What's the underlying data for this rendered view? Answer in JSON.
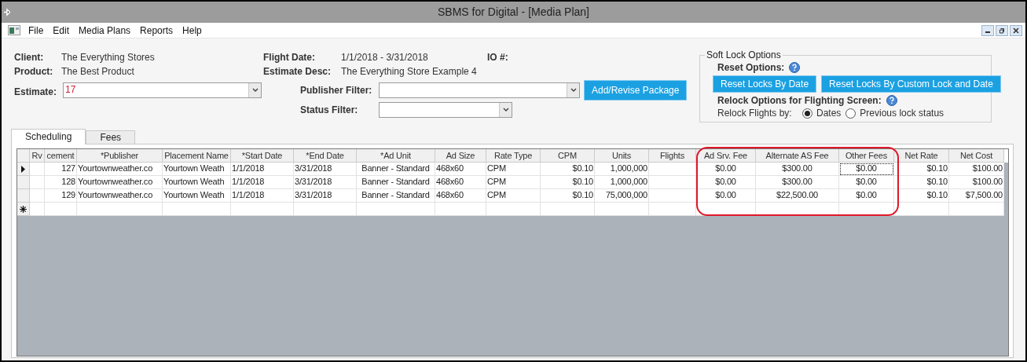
{
  "window": {
    "title": "SBMS for Digital - [Media Plan]"
  },
  "menu": [
    "File",
    "Edit",
    "Media Plans",
    "Reports",
    "Help"
  ],
  "header": {
    "client_label": "Client:",
    "client": "The Everything Stores",
    "product_label": "Product:",
    "product": "The Best Product",
    "estimate_label": "Estimate:",
    "estimate": "17",
    "flight_date_label": "Flight Date:",
    "flight_date": "1/1/2018 - 3/31/2018",
    "io_label": "IO #:",
    "estimate_desc_label": "Estimate Desc:",
    "estimate_desc": "The Everything Store Example 4",
    "publisher_filter_label": "Publisher Filter:",
    "status_filter_label": "Status Filter:",
    "add_button": "Add/Revise Package"
  },
  "soft_lock": {
    "title": "Soft Lock Options",
    "reset_label": "Reset Options:",
    "buttons": [
      "Reset Locks By Date",
      "Reset Locks By Custom Lock and Date"
    ],
    "relock_label": "Relock Options for Flighting Screen:",
    "relock_by_label": "Relock Flights by:",
    "options": [
      {
        "label": "Dates",
        "selected": true
      },
      {
        "label": "Previous lock status",
        "selected": false
      }
    ]
  },
  "tabs": [
    {
      "label": "Scheduling",
      "selected": true
    },
    {
      "label": "Fees",
      "selected": false
    }
  ],
  "table": {
    "columns": [
      "Rv",
      "cement",
      "*Publisher",
      "Placement Name",
      "*Start Date",
      "*End Date",
      "*Ad Unit",
      "Ad Size",
      "Rate Type",
      "CPM",
      "Units",
      "Flights",
      "Ad Srv. Fee",
      "Alternate AS Fee",
      "Other Fees",
      "Net Rate",
      "Net Cost"
    ],
    "rows": [
      {
        "selected": true,
        "cells": [
          {
            "text": "",
            "focused": false
          },
          {
            "text": "127",
            "focused": false
          },
          {
            "text": "Yourtownweather.co",
            "focused": false
          },
          {
            "text": "Yourtown Weath",
            "focused": false
          },
          {
            "text": "1/1/2018",
            "focused": false
          },
          {
            "text": "3/31/2018",
            "focused": false
          },
          {
            "text": "Banner - Standard",
            "focused": false
          },
          {
            "text": "468x60",
            "focused": false
          },
          {
            "text": "CPM",
            "focused": false
          },
          {
            "text": "$0.10",
            "focused": false
          },
          {
            "text": "1,000,000",
            "focused": false
          },
          {
            "text": "",
            "focused": false
          },
          {
            "text": "$0.00",
            "focused": false
          },
          {
            "text": "$300.00",
            "focused": false
          },
          {
            "text": "$0.00",
            "focused": true
          },
          {
            "text": "$0.10",
            "focused": false
          },
          {
            "text": "$100.00",
            "focused": false
          }
        ]
      },
      {
        "selected": false,
        "cells": [
          {
            "text": "",
            "focused": false
          },
          {
            "text": "128",
            "focused": false
          },
          {
            "text": "Yourtownweather.co",
            "focused": false
          },
          {
            "text": "Yourtown Weath",
            "focused": false
          },
          {
            "text": "1/1/2018",
            "focused": false
          },
          {
            "text": "3/31/2018",
            "focused": false
          },
          {
            "text": "Banner - Standard",
            "focused": false
          },
          {
            "text": "468x60",
            "focused": false
          },
          {
            "text": "CPM",
            "focused": false
          },
          {
            "text": "$0.10",
            "focused": false
          },
          {
            "text": "1,000,000",
            "focused": false
          },
          {
            "text": "",
            "focused": false
          },
          {
            "text": "$0.00",
            "focused": false
          },
          {
            "text": "$300.00",
            "focused": false
          },
          {
            "text": "$0.00",
            "focused": false
          },
          {
            "text": "$0.10",
            "focused": false
          },
          {
            "text": "$100.00",
            "focused": false
          }
        ]
      },
      {
        "selected": false,
        "cells": [
          {
            "text": "",
            "focused": false
          },
          {
            "text": "129",
            "focused": false
          },
          {
            "text": "Yourtownweather.co",
            "focused": false
          },
          {
            "text": "Yourtown Weath",
            "focused": false
          },
          {
            "text": "1/1/2018",
            "focused": false
          },
          {
            "text": "3/31/2018",
            "focused": false
          },
          {
            "text": "Banner - Standard",
            "focused": false
          },
          {
            "text": "468x60",
            "focused": false
          },
          {
            "text": "CPM",
            "focused": false
          },
          {
            "text": "$0.10",
            "focused": false
          },
          {
            "text": "75,000,000",
            "focused": false
          },
          {
            "text": "",
            "focused": false
          },
          {
            "text": "$0.00",
            "focused": false
          },
          {
            "text": "$22,500.00",
            "focused": false
          },
          {
            "text": "$0.00",
            "focused": false
          },
          {
            "text": "$0.10",
            "focused": false
          },
          {
            "text": "$7,500.00",
            "focused": false
          }
        ]
      }
    ]
  }
}
